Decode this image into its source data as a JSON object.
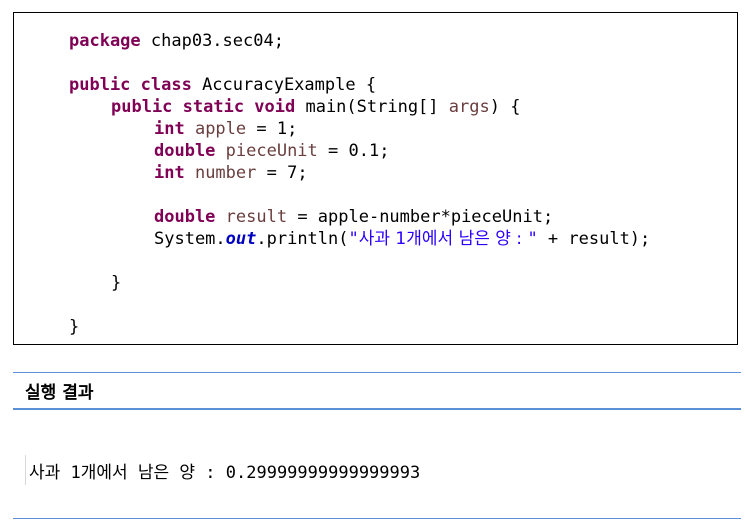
{
  "code": {
    "line1": {
      "kw": "package",
      "rest": " chap03.sec04;"
    },
    "line2": {
      "kw": "public class",
      "rest": " AccuracyExample {"
    },
    "line3": {
      "kw": "public static void",
      "rest1": " main(String[] ",
      "var": "args",
      "rest2": ") {"
    },
    "line4": {
      "kw": "int",
      "var": " apple",
      "rest": " = 1;"
    },
    "line5": {
      "kw": "double",
      "var": " pieceUnit",
      "rest": " = 0.1;"
    },
    "line6": {
      "kw": "int",
      "var": " number",
      "rest": " = 7;"
    },
    "line7": {
      "kw": "double",
      "var": " result",
      "rest": " = apple-number*pieceUnit;"
    },
    "line8": {
      "pre": "System.",
      "field": "out",
      "mid": ".println(",
      "q1": "\"",
      "str_ko": "사과 1개에서 남은 양 : ",
      "q2": "\"",
      "post": " + result);"
    },
    "line9": "}",
    "line10": "}"
  },
  "result": {
    "title": "실행 결과",
    "output": "사과 1개에서 남은 양 : 0.29999999999999993"
  }
}
